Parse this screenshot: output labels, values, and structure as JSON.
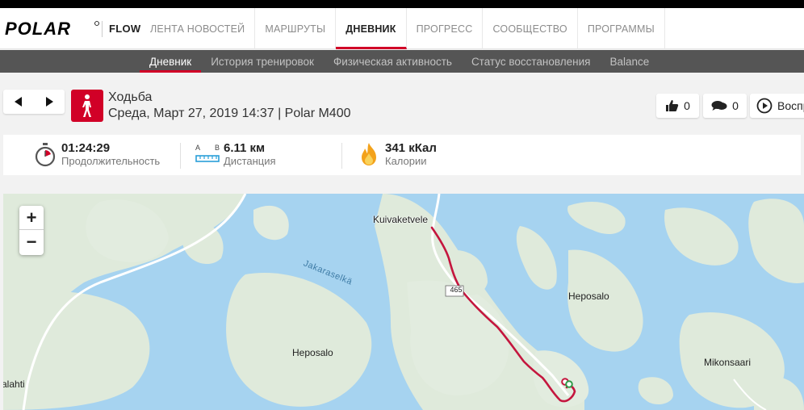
{
  "brand": {
    "logo": "POLAR",
    "product": "FLOW"
  },
  "topnav": {
    "items": [
      {
        "label": "ЛЕНТА НОВОСТЕЙ"
      },
      {
        "label": "МАРШРУТЫ"
      },
      {
        "label": "ДНЕВНИК"
      },
      {
        "label": "ПРОГРЕСС"
      },
      {
        "label": "СООБЩЕСТВО"
      },
      {
        "label": "ПРОГРАММЫ"
      }
    ],
    "active": "ДНЕВНИК"
  },
  "subnav": {
    "items": [
      {
        "label": "Дневник"
      },
      {
        "label": "История тренировок"
      },
      {
        "label": "Физическая активность"
      },
      {
        "label": "Статус восстановления"
      },
      {
        "label": "Balance"
      }
    ],
    "active": "Дневник"
  },
  "session": {
    "sport_icon": "walking-person-icon",
    "sport": "Ходьба",
    "subtitle": "Среда, Март 27, 2019 14:37 | Polar M400"
  },
  "social": {
    "likes": "0",
    "comments": "0",
    "replay_label": "Воспр"
  },
  "stats": {
    "duration": {
      "value": "01:24:29",
      "label": "Продолжительность",
      "icon": "stopwatch-icon"
    },
    "distance": {
      "value": "6.11 км",
      "label": "Дистанция",
      "icon": "distance-ruler-icon",
      "icon_a": "A",
      "icon_b": "B"
    },
    "calories": {
      "value": "341 кКал",
      "label": "Калории",
      "icon": "flame-icon"
    }
  },
  "map": {
    "zoom_in": "+",
    "zoom_out": "−",
    "labels": {
      "kuivaketvele": "Kuivaketvele",
      "jakaraselka": "Jakaraselkä",
      "heposalo_east": "Heposalo",
      "heposalo_west": "Heposalo",
      "mikonsaari": "Mikonsaari",
      "lahti": "alahti",
      "road_number": "465"
    },
    "colors": {
      "water": "#a6d3f0",
      "land": "#dfeadb",
      "route": "#c4163e",
      "road": "#ffffff"
    }
  }
}
